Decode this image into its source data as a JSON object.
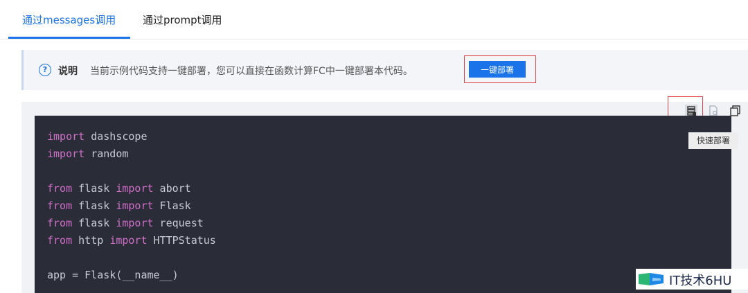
{
  "tabs": [
    {
      "label": "通过messages调用",
      "active": true
    },
    {
      "label": "通过prompt调用",
      "active": false
    }
  ],
  "notice": {
    "label": "说明",
    "text": "当前示例代码支持一键部署，您可以直接在函数计算FC中一键部署本代码。",
    "deploy_button": "一键部署"
  },
  "toolbar": {
    "tooltip": "快速部署",
    "icons": [
      "quick-deploy-icon",
      "run-file-icon",
      "copy-icon"
    ]
  },
  "code": {
    "lines": [
      {
        "kw": "import",
        "rest": " dashscope"
      },
      {
        "kw": "import",
        "rest": " random"
      },
      {
        "kw": "from",
        "mid": " flask ",
        "kw2": "import",
        "rest": " abort"
      },
      {
        "kw": "from",
        "mid": " flask ",
        "kw2": "import",
        "rest": " Flask"
      },
      {
        "kw": "from",
        "mid": " flask ",
        "kw2": "import",
        "rest": " request"
      },
      {
        "kw": "from",
        "mid": " http ",
        "kw2": "import",
        "rest": " HTTPStatus"
      },
      {
        "plain": "app = Flask(__name__)"
      }
    ]
  },
  "watermark": {
    "text": "IT技术6HU"
  },
  "colors": {
    "accent": "#1a73e8",
    "highlight_border": "#e0464b",
    "code_bg": "#2a2c37",
    "keyword": "#cf6fc8"
  }
}
